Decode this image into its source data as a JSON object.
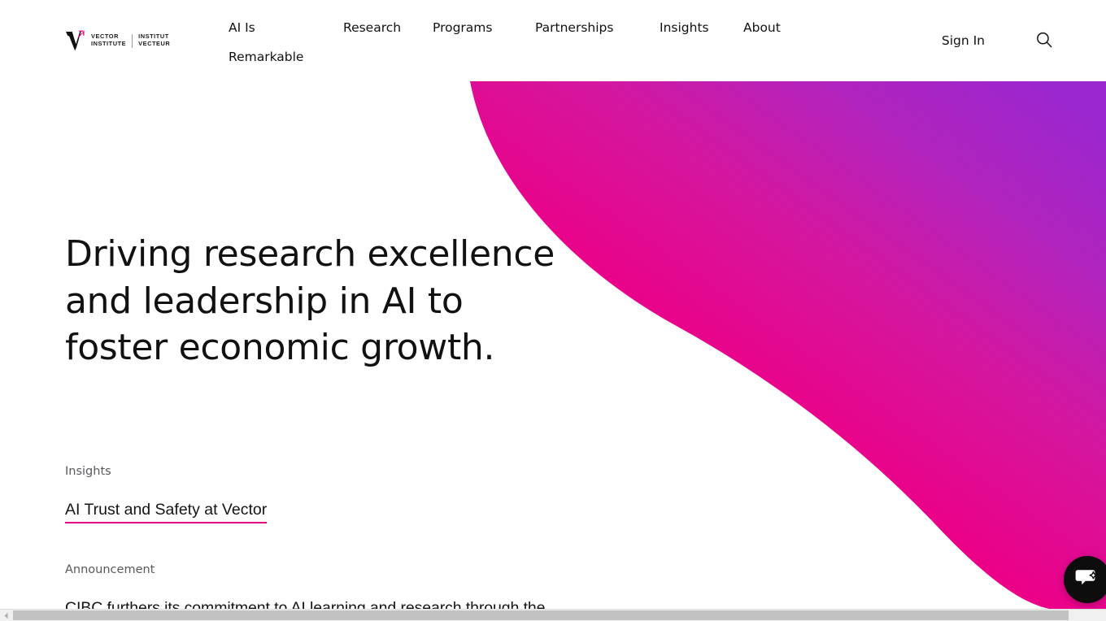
{
  "header": {
    "logo": {
      "name": "Vector Institute",
      "line1_en": "VECTOR",
      "line2_en": "INSTITUTE",
      "line1_fr": "INSTITUT",
      "line2_fr": "VECTEUR",
      "mark_color": "#ec008c"
    },
    "nav": [
      {
        "label": "AI Is Remarkable",
        "name": "nav-item-ai-is-remarkable"
      },
      {
        "label": "Research",
        "name": "nav-item-research"
      },
      {
        "label": "Programs",
        "name": "nav-item-programs"
      },
      {
        "label": "Partnerships",
        "name": "nav-item-partnerships"
      },
      {
        "label": "Insights",
        "name": "nav-item-insights"
      },
      {
        "label": "About",
        "name": "nav-item-about"
      }
    ],
    "sign_in_label": "Sign In",
    "search_icon": "search-icon"
  },
  "hero": {
    "heading": "Driving research excellence and leadership in AI to foster economic growth.",
    "gradient": {
      "from": "#ec0089",
      "via": "#e4007d",
      "to": "#9b27cf"
    },
    "blocks": [
      {
        "eyebrow": "Insights",
        "link_text": "AI Trust and Safety at Vector",
        "underline_color": "#e6007e"
      },
      {
        "eyebrow": "Announcement",
        "link_text": "CIBC furthers its commitment to AI learning and research through the",
        "underline_color": "#e6007e"
      }
    ]
  },
  "chat_widget": {
    "icon": "chat-sparkle-icon",
    "background": "#0d0d0d"
  },
  "scrollbar": {
    "left_arrow_icon": "scroll-left-arrow-icon",
    "thumb_color": "#c2c2c2",
    "track_color": "#f0f0f0"
  }
}
